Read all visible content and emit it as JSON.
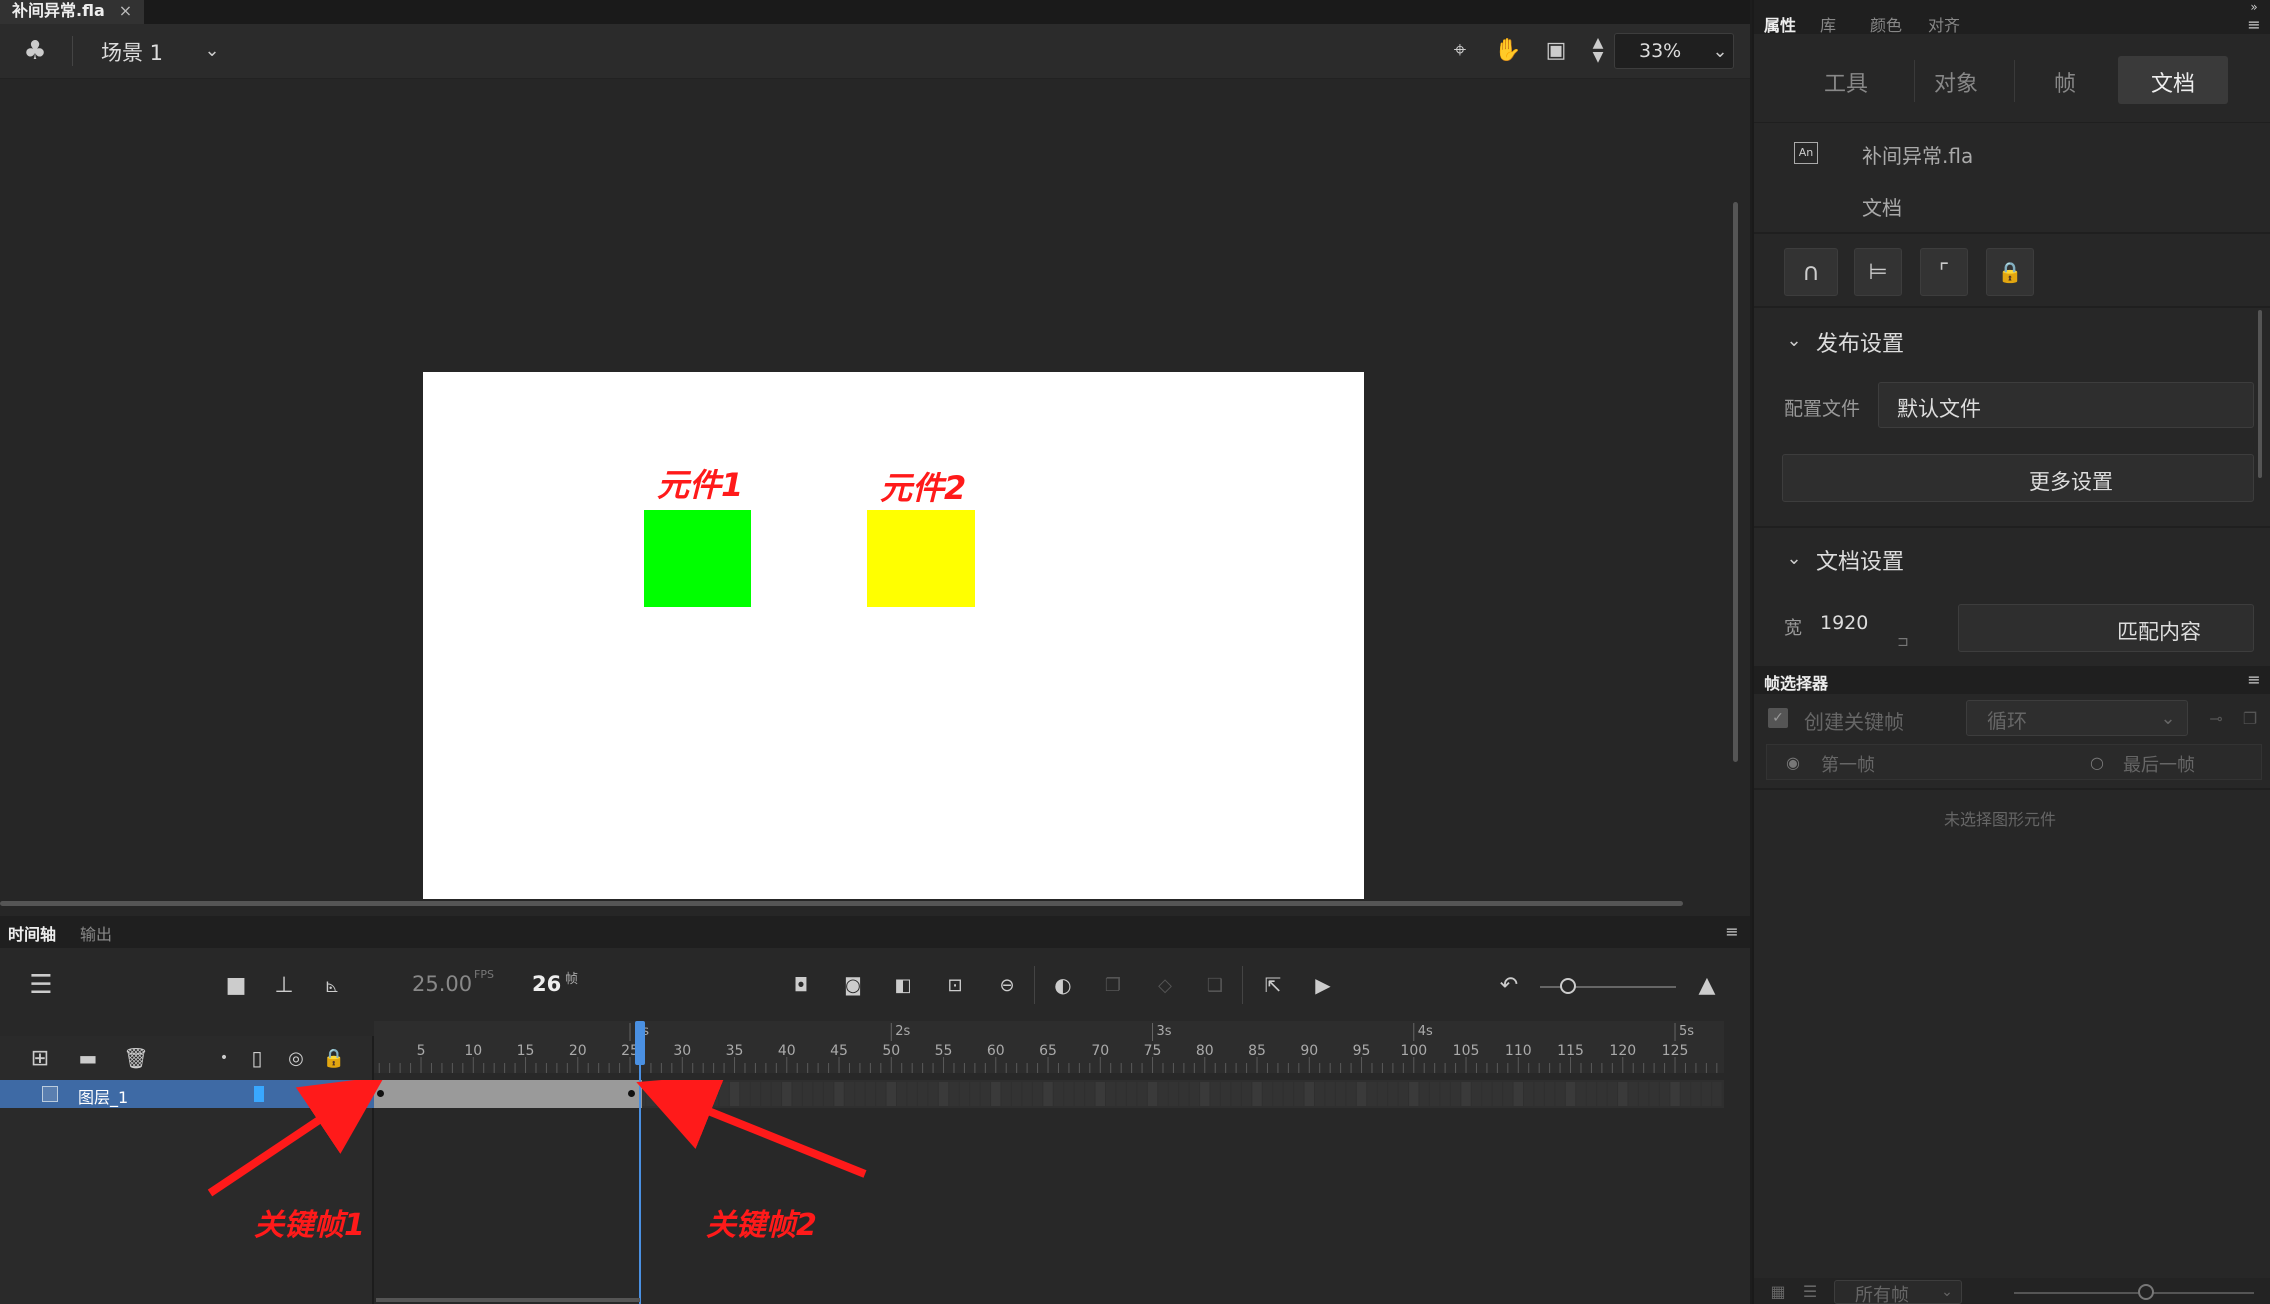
{
  "document_tab": {
    "title": "补间异常.fla",
    "close": "×"
  },
  "scene_bar": {
    "scene_label": "场景 1",
    "zoom": "33%"
  },
  "stage": {
    "symbols": [
      {
        "label": "元件1",
        "color": "#00ff00"
      },
      {
        "label": "元件2",
        "color": "#ffff00"
      }
    ]
  },
  "timeline": {
    "tabs": [
      "时间轴",
      "输出"
    ],
    "fps": "25.00",
    "fps_unit": "FPS",
    "current_frame": "26",
    "frame_unit": "帧",
    "layer_name": "图层_1",
    "seconds": [
      "1s",
      "2s",
      "3s",
      "4s",
      "5s"
    ],
    "frame_ticks": [
      "5",
      "10",
      "15",
      "20",
      "25",
      "30",
      "35",
      "40",
      "45",
      "50",
      "55",
      "60",
      "65",
      "70",
      "75",
      "80",
      "85",
      "90",
      "95",
      "100",
      "105",
      "110",
      "115",
      "120",
      "125"
    ],
    "playhead_frame": 26
  },
  "annotations": {
    "keyframe1": "关键帧1",
    "keyframe2": "关键帧2"
  },
  "right_panel": {
    "tabs": [
      "属性",
      "库",
      "颜色",
      "对齐"
    ],
    "subtabs": [
      "工具",
      "对象",
      "帧",
      "文档"
    ],
    "active_subtab": "文档",
    "doc_icon": "An",
    "doc_name": "补间异常.fla",
    "doc_type": "文档",
    "publish_header": "发布设置",
    "profile_label": "配置文件",
    "profile_value": "默认文件",
    "more_settings": "更多设置",
    "doc_settings_header": "文档设置",
    "width_label": "宽",
    "width_value": "1920",
    "match_content": "匹配内容"
  },
  "frame_picker": {
    "title": "帧选择器",
    "create_keyframe": "创建关键帧",
    "loop": "循环",
    "first_frame": "第一帧",
    "last_frame": "最后一帧",
    "empty_message": "未选择图形元件",
    "all_frames": "所有帧"
  }
}
